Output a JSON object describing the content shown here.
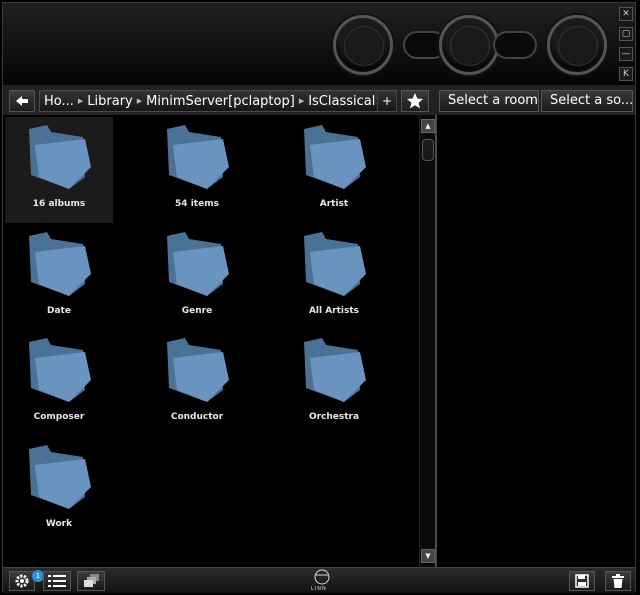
{
  "window_controls": {
    "close": "✕",
    "restore": "▢",
    "minimize": "—",
    "mini_mode": "K"
  },
  "breadcrumb": {
    "items": [
      "Ho...",
      "Library",
      "MinimServer[pclaptop]",
      "IsClassical"
    ],
    "add_label": "+"
  },
  "room_select": {
    "label": "Select a room"
  },
  "source_select": {
    "label": "Select a so..."
  },
  "folders": [
    {
      "label": "16 albums",
      "selected": true
    },
    {
      "label": "54 items"
    },
    {
      "label": "Artist"
    },
    {
      "label": "Date"
    },
    {
      "label": "Genre"
    },
    {
      "label": "All Artists"
    },
    {
      "label": "Composer"
    },
    {
      "label": "Conductor"
    },
    {
      "label": "Orchestra"
    },
    {
      "label": "Work"
    }
  ],
  "bottom": {
    "settings_badge": "1",
    "logo_text": "LINN"
  },
  "colors": {
    "folder": "#6a94bf",
    "background": "#000000",
    "badge": "#2f8fd0"
  }
}
